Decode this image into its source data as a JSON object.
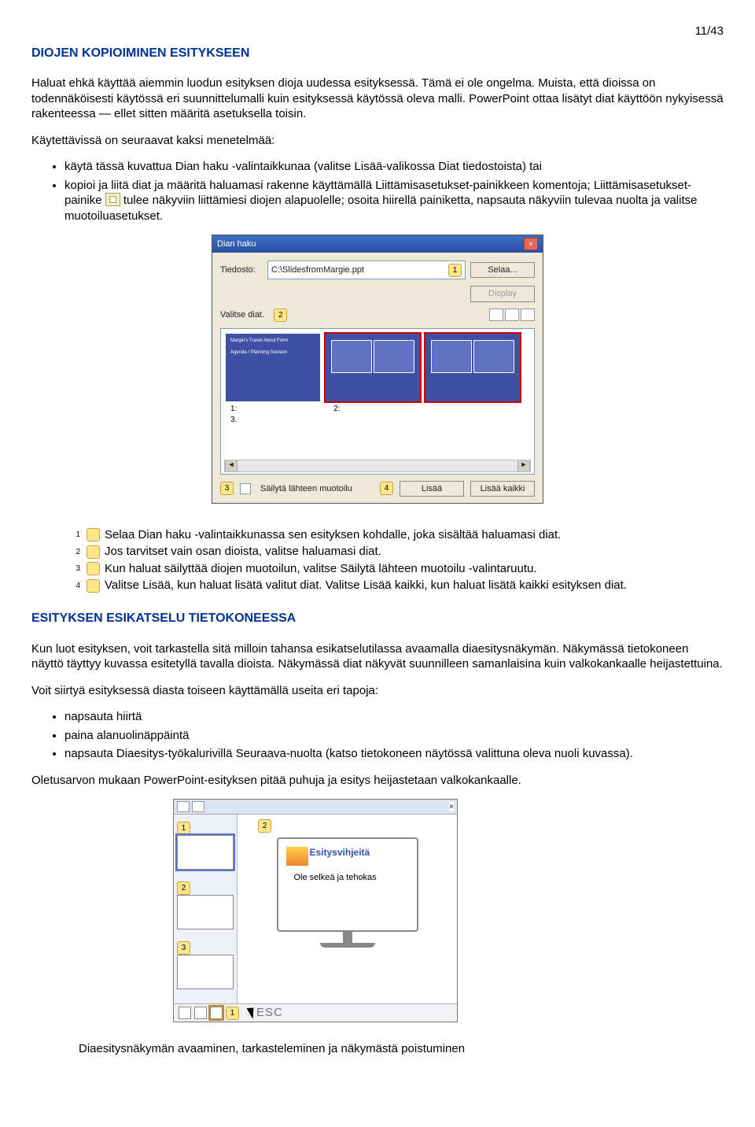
{
  "page_number": "11/43",
  "heading1": "DIOJEN KOPIOIMINEN ESITYKSEEN",
  "para1": "Haluat ehkä käyttää aiemmin luodun esityksen dioja uudessa esityksessä. Tämä ei ole ongelma. Muista, että dioissa on todennäköisesti käytössä eri suunnittelumalli kuin esityksessä käytössä oleva malli. PowerPoint ottaa lisätyt diat käyttöön nykyisessä rakenteessa — ellet sitten määritä asetuksella toisin.",
  "para2": "Käytettävissä on seuraavat kaksi menetelmää:",
  "bullets1": [
    "käytä tässä kuvattua Dian haku -valintaikkunaa (valitse Lisää-valikossa Diat tiedostoista) tai",
    "kopioi ja liitä diat ja määritä haluamasi rakenne käyttämällä Liittämisasetukset-painikkeen komentoja; Liittämisasetukset-painike "
  ],
  "bullets1_b_tail": "tulee näkyviin liittämiesi diojen alapuolelle; osoita hiirellä painiketta, napsauta näkyviin tulevaa nuolta ja valitse muotoiluasetukset.",
  "dialog": {
    "title": "Dian haku",
    "file_label": "Tiedosto:",
    "file_value": "C:\\SlidesfromMargie.ppt",
    "browse": "Selaa...",
    "display": "Display",
    "select_label": "Valitse diat.",
    "slide1": "1:",
    "slide2": "2:",
    "slide3": "3.",
    "keep_fmt": "Säilytä lähteen muotoilu",
    "insert": "Lisää",
    "insert_all": "Lisää kaikki",
    "c1": "1",
    "c2": "2",
    "c3": "3",
    "c4": "4"
  },
  "steps": {
    "s1": "Selaa Dian haku -valintaikkunassa sen esityksen kohdalle, joka sisältää haluamasi diat.",
    "s2": "Jos tarvitset vain osan dioista, valitse haluamasi diat.",
    "s3": "Kun haluat säilyttää diojen muotoilun, valitse Säilytä lähteen muotoilu -valintaruutu.",
    "s4": "Valitse Lisää, kun haluat lisätä valitut diat. Valitse Lisää kaikki, kun haluat lisätä kaikki esityksen diat."
  },
  "heading2": "ESITYKSEN ESIKATSELU TIETOKONEESSA",
  "para3": "Kun luot esityksen, voit tarkastella sitä milloin tahansa esikatselutilassa avaamalla diaesitysnäkymän. Näkymässä tietokoneen näyttö täyttyy kuvassa esitetyllä tavalla dioista. Näkymässä diat näkyvät suunnilleen samanlaisina kuin valkokankaalle heijastettuina.",
  "para4": "Voit siirtyä esityksessä diasta toiseen käyttämällä useita eri tapoja:",
  "bullets2": [
    "napsauta hiirtä",
    "paina alanuolinäppäintä",
    "napsauta Diaesitys-työkalurivillä Seuraava-nuolta (katso tietokoneen näytössä valittuna oleva nuoli kuvassa)."
  ],
  "para5": "Oletusarvon mukaan PowerPoint-esityksen pitää puhuja ja esitys heijastetaan valkokankaalle.",
  "monitor": {
    "title": "Esitysvihjeitä",
    "sub": "Ole selkeä ja tehokas",
    "esc": "ESC",
    "c1": "1",
    "c2": "2",
    "c3": "3"
  },
  "footer": "Diaesitysnäkymän avaaminen, tarkasteleminen ja näkymästä poistuminen"
}
